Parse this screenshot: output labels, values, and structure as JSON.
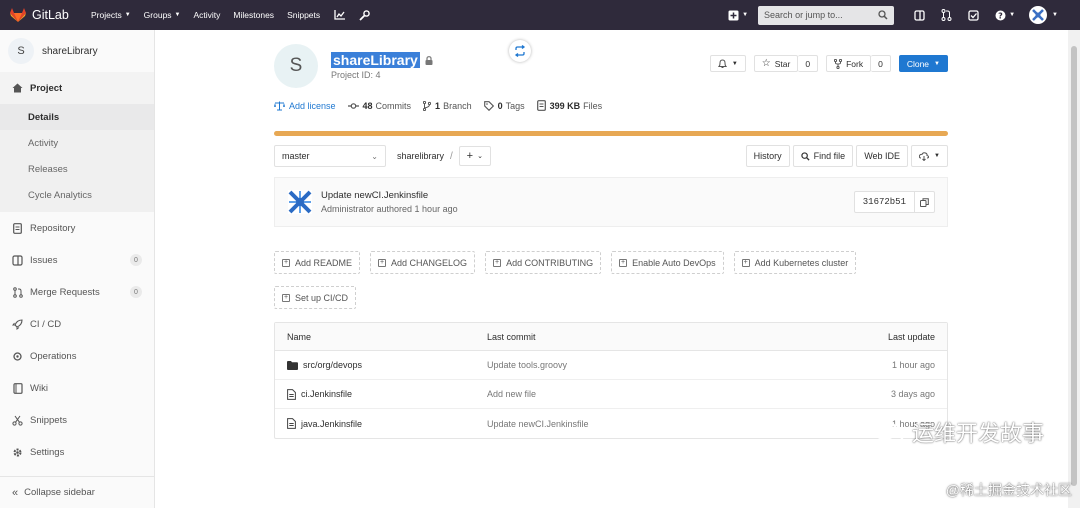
{
  "navbar": {
    "brand": "GitLab",
    "items": [
      {
        "label": "Projects",
        "caret": true
      },
      {
        "label": "Groups",
        "caret": true
      },
      {
        "label": "Activity",
        "caret": false
      },
      {
        "label": "Milestones",
        "caret": false
      },
      {
        "label": "Snippets",
        "caret": false
      }
    ],
    "search_placeholder": "Search or jump to...",
    "colors": {
      "bg": "#2f2a3b",
      "accent": "#e24329"
    }
  },
  "sidebar": {
    "project_initial": "S",
    "project_name": "shareLibrary",
    "section": "Project",
    "sub_items": [
      "Details",
      "Activity",
      "Releases",
      "Cycle Analytics"
    ],
    "items": [
      {
        "label": "Repository",
        "icon": "doc-icon",
        "badge": ""
      },
      {
        "label": "Issues",
        "icon": "issues-icon",
        "badge": "0"
      },
      {
        "label": "Merge Requests",
        "icon": "merge-icon",
        "badge": "0"
      },
      {
        "label": "CI / CD",
        "icon": "rocket-icon",
        "badge": ""
      },
      {
        "label": "Operations",
        "icon": "cloud-gear-icon",
        "badge": ""
      },
      {
        "label": "Wiki",
        "icon": "book-icon",
        "badge": ""
      },
      {
        "label": "Snippets",
        "icon": "scissors-icon",
        "badge": ""
      },
      {
        "label": "Settings",
        "icon": "gear-icon",
        "badge": ""
      }
    ],
    "collapse_label": "Collapse sidebar"
  },
  "project": {
    "initial": "S",
    "name": "shareLibrary",
    "id_label": "Project ID: 4",
    "star_label": "Star",
    "star_count": "0",
    "fork_label": "Fork",
    "fork_count": "0",
    "clone_label": "Clone"
  },
  "stats": {
    "add_license": "Add license",
    "commits_count": "48",
    "commits_label": "Commits",
    "branch_count": "1",
    "branch_label": "Branch",
    "tags_count": "0",
    "tags_label": "Tags",
    "files_size": "399 KB",
    "files_label": "Files"
  },
  "toolbar": {
    "branch": "master",
    "breadcrumb": "sharelibrary",
    "separator": "/",
    "buttons": [
      "History",
      "Find file",
      "Web IDE"
    ]
  },
  "commit": {
    "title": "Update newCI.Jenkinsfile",
    "meta": "Administrator authored 1 hour ago",
    "sha": "31672b51"
  },
  "quick_actions": [
    "Add README",
    "Add CHANGELOG",
    "Add CONTRIBUTING",
    "Enable Auto DevOps",
    "Add Kubernetes cluster",
    "Set up CI/CD"
  ],
  "tree": {
    "headers": {
      "name": "Name",
      "commit": "Last commit",
      "update": "Last update"
    },
    "rows": [
      {
        "type": "folder",
        "name": "src/org/devops",
        "commit": "Update tools.groovy",
        "update": "1 hour ago"
      },
      {
        "type": "file",
        "name": "ci.Jenkinsfile",
        "commit": "Add new file",
        "update": "3 days ago"
      },
      {
        "type": "file",
        "name": "java.Jenkinsfile",
        "commit": "Update newCI.Jenkinsfile",
        "update": "1 hour ago"
      }
    ]
  },
  "watermark": {
    "line1": "运维开发故事",
    "line2": "@稀土掘金技术社区"
  }
}
